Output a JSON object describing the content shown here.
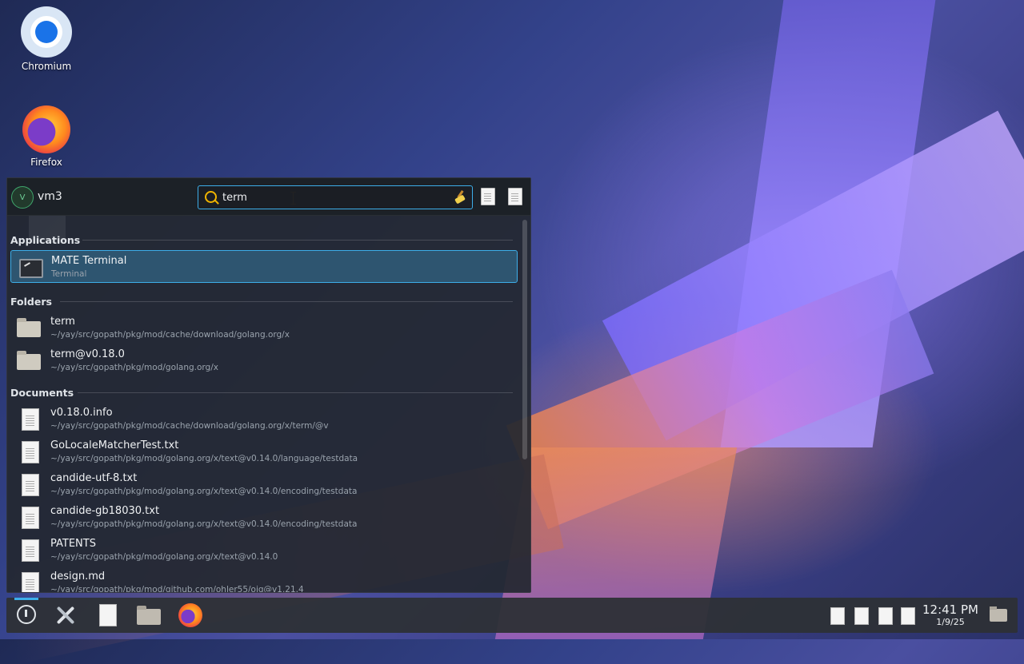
{
  "desktop": {
    "icons": [
      {
        "label": "Chromium"
      },
      {
        "label": "Firefox"
      }
    ]
  },
  "launcher": {
    "hostname": "vm3",
    "avatar_letter": "V",
    "search": {
      "value": "term",
      "placeholder": ""
    },
    "sections": {
      "applications": {
        "title": "Applications",
        "items": [
          {
            "name": "MATE Terminal",
            "detail": "Terminal",
            "icon": "terminal-icon"
          }
        ]
      },
      "folders": {
        "title": "Folders",
        "items": [
          {
            "name": "term",
            "detail": "~/yay/src/gopath/pkg/mod/cache/download/golang.org/x",
            "icon": "folder-icon"
          },
          {
            "name": "term@v0.18.0",
            "detail": "~/yay/src/gopath/pkg/mod/golang.org/x",
            "icon": "folder-icon"
          }
        ]
      },
      "documents": {
        "title": "Documents",
        "items": [
          {
            "name": "v0.18.0.info",
            "detail": "~/yay/src/gopath/pkg/mod/cache/download/golang.org/x/term/@v",
            "icon": "document-icon"
          },
          {
            "name": "GoLocaleMatcherTest.txt",
            "detail": "~/yay/src/gopath/pkg/mod/golang.org/x/text@v0.14.0/language/testdata",
            "icon": "document-icon"
          },
          {
            "name": "candide-utf-8.txt",
            "detail": "~/yay/src/gopath/pkg/mod/golang.org/x/text@v0.14.0/encoding/testdata",
            "icon": "document-icon"
          },
          {
            "name": "candide-gb18030.txt",
            "detail": "~/yay/src/gopath/pkg/mod/golang.org/x/text@v0.14.0/encoding/testdata",
            "icon": "document-icon"
          },
          {
            "name": "PATENTS",
            "detail": "~/yay/src/gopath/pkg/mod/golang.org/x/text@v0.14.0",
            "icon": "document-icon"
          },
          {
            "name": "design.md",
            "detail": "~/yay/src/gopath/pkg/mod/github.com/ohler55/ojg@v1.21.4",
            "icon": "document-icon"
          }
        ]
      }
    }
  },
  "taskbar": {
    "clock": {
      "time": "12:41 PM",
      "date": "1/9/25"
    }
  },
  "colors": {
    "accent": "#3daee9",
    "menu_bg": "#23282f",
    "selected_bg": "#2e5570",
    "panel_bg": "#2d3036"
  }
}
